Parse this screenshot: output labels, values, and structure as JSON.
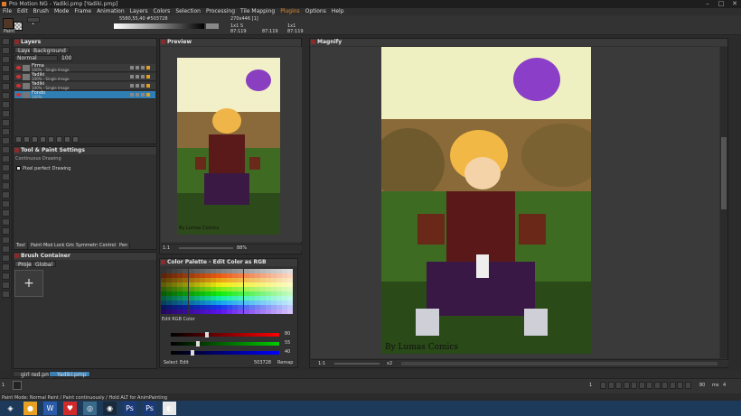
{
  "app": {
    "title": "Pro Motion NG - Yadiki.pmp [Yadiki.pmp]",
    "menu": [
      "File",
      "Edit",
      "Brush",
      "Mode",
      "Frame",
      "Animation",
      "Layers",
      "Colors",
      "Selection",
      "Processing",
      "Tile Mapping",
      "Plugins",
      "Options",
      "Help"
    ]
  },
  "tool_options": {
    "brush_label": "1",
    "paint_label": "Paint",
    "coords": "5580,55,40 #503728",
    "size_info": "270x446 [1]",
    "scale": "1x1 S",
    "readout1": "87:119",
    "readout2": "87:119",
    "readout3": "1x1",
    "readout4": "87:119"
  },
  "layers_panel": {
    "title": "Layers",
    "tabs": [
      "Layers",
      "Background"
    ],
    "blend_mode": "Normal",
    "opacity": "100",
    "rows": [
      {
        "name": "Firma",
        "sub": "100% - Single Image",
        "selected": false
      },
      {
        "name": "Yadiki",
        "sub": "100% - Single Image",
        "selected": false
      },
      {
        "name": "Yadiki",
        "sub": "100% - Single Image",
        "selected": false
      },
      {
        "name": "Fondo",
        "sub": "100%",
        "selected": true
      }
    ]
  },
  "tool_settings": {
    "title": "Tool & Paint Settings",
    "section": "Continuous Drawing",
    "checkbox_label": "Pixel perfect Drawing",
    "subtabs": [
      "Tool",
      "Paint Mode",
      "Lock Grid",
      "Symmetry",
      "Control",
      "Pen"
    ]
  },
  "brush_container": {
    "title": "Brush Container",
    "tabs": [
      "Project",
      "Global"
    ],
    "add_label": "+"
  },
  "preview": {
    "title": "Preview",
    "zoom": "88%",
    "ratio": "1:1",
    "signature": "By Lumas Comics"
  },
  "color_palette": {
    "title": "Color Palette - Edit Color as RGB",
    "edit_label": "Edit RGB Color",
    "r_value": "80",
    "g_value": "55",
    "b_value": "40",
    "select_label": "Select",
    "edit_tab": "Edit",
    "hex_value": "503728",
    "remap_label": "Remap"
  },
  "magnify": {
    "title": "Magnify",
    "ratio": "1:1",
    "zoom": "x2",
    "signature": "By Lumas Comics"
  },
  "docs": {
    "tabs": [
      "girl red.pmp",
      "Yadiki.pmp"
    ]
  },
  "anim": {
    "frame": "1",
    "speed": "80",
    "unit": "ms",
    "count": "1",
    "frames_right": "4"
  },
  "status": {
    "text": "Paint Mode: Normal Paint / Paint continuously / Hold ALT for AnimPainting"
  },
  "taskbar": {
    "items": [
      "start-icon",
      "chrome-icon",
      "word-icon",
      "heart-icon",
      "app-icon",
      "steam-icon",
      "photoshop-icon",
      "photoshop2-icon",
      "promotion-icon"
    ]
  },
  "colors": {
    "accent": "#2f7fb5",
    "primary_swatch": "#503728",
    "window_bg": "#2b2b2b"
  }
}
